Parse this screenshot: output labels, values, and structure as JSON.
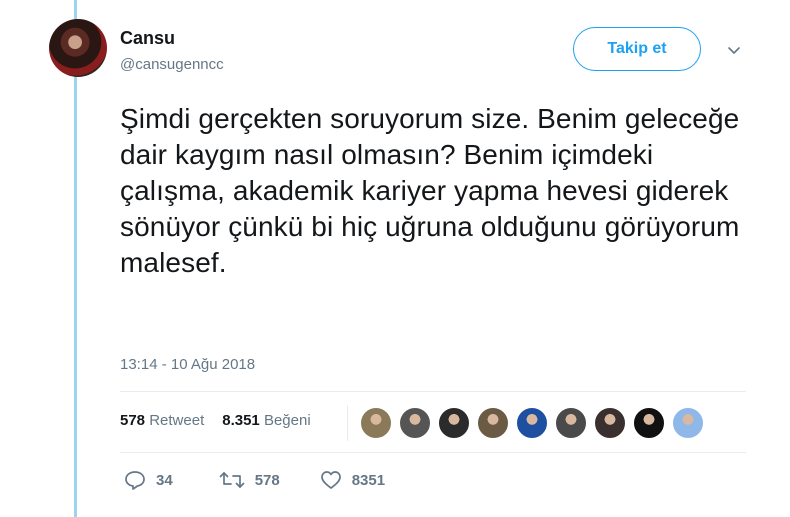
{
  "author": {
    "name": "Cansu",
    "handle": "@cansugenncc"
  },
  "follow_label": "Takip et",
  "tweet_text": "Şimdi gerçekten soruyorum size. Benim geleceğe dair kaygım nasıl olmasın? Benim içimdeki çalışma, akademik kariyer yapma hevesi giderek sönüyor çünkü bi hiç uğruna olduğunu görüyorum malesef.",
  "timestamp": "13:14 - 10 Ağu 2018",
  "stats": {
    "retweet_count": "578",
    "retweet_label": "Retweet",
    "like_count": "8.351",
    "like_label": "Beğeni"
  },
  "liker_avatars": [
    "#8a7a5a",
    "#555555",
    "#2b2b2b",
    "#6b5a44",
    "#1f4fa0",
    "#4a4a4a",
    "#3a3030",
    "#111111",
    "#8fb7e8"
  ],
  "actions": {
    "reply_count": "34",
    "retweet_count": "578",
    "like_count": "8351"
  },
  "icons": [
    "chevron-down-icon",
    "reply-icon",
    "retweet-icon",
    "heart-icon"
  ],
  "colors": {
    "accent": "#1da1f2",
    "thread_line": "#9cd3f3",
    "muted": "#657786"
  }
}
